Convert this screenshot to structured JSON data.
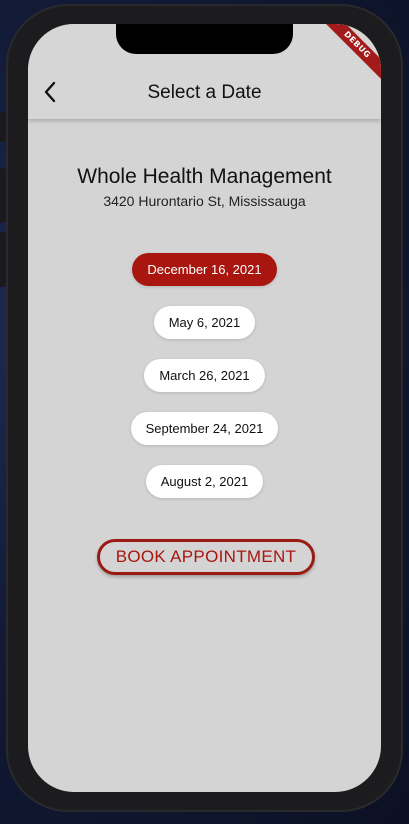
{
  "appbar": {
    "title": "Select a Date",
    "back_icon": "chevron-left-icon"
  },
  "debug_banner": "DEBUG",
  "clinic": {
    "name": "Whole Health Management",
    "address": "3420 Hurontario St, Mississauga"
  },
  "dates": [
    {
      "label": "December 16, 2021",
      "selected": true
    },
    {
      "label": "May 6, 2021",
      "selected": false
    },
    {
      "label": "March 26, 2021",
      "selected": false
    },
    {
      "label": "September 24, 2021",
      "selected": false
    },
    {
      "label": "August 2, 2021",
      "selected": false
    }
  ],
  "book_button": {
    "label": "BOOK APPOINTMENT"
  },
  "colors": {
    "accent": "#a8160f",
    "background": "#d4d4d4",
    "chip": "#ffffff"
  }
}
